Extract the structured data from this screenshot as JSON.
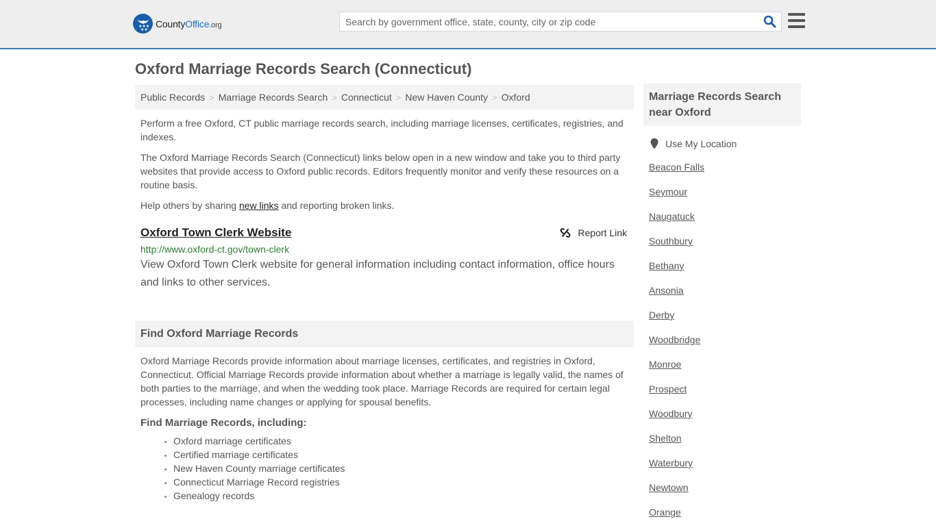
{
  "header": {
    "logo": {
      "name_part1": "County",
      "name_part2": "Office",
      "name_suffix": ".org"
    },
    "search": {
      "placeholder": "Search by government office, state, county, city or zip code",
      "value": ""
    },
    "colors": {
      "brand_blue": "#1a5ea8",
      "header_border": "#3b7bb5",
      "header_bg": "#eeeeee"
    }
  },
  "page": {
    "title": "Oxford Marriage Records Search (Connecticut)"
  },
  "breadcrumb": [
    {
      "label": "Public Records"
    },
    {
      "label": "Marriage Records Search"
    },
    {
      "label": "Connecticut"
    },
    {
      "label": "New Haven County"
    },
    {
      "label": "Oxford"
    }
  ],
  "intro": {
    "p1": "Perform a free Oxford, CT public marriage records search, including marriage licenses, certificates, registries, and indexes.",
    "p2": "The Oxford Marriage Records Search (Connecticut) links below open in a new window and take you to third party websites that provide access to Oxford public records. Editors frequently monitor and verify these resources on a routine basis.",
    "p3_before": "Help others by sharing ",
    "p3_link": "new links",
    "p3_after": " and reporting broken links."
  },
  "resource": {
    "title": "Oxford Town Clerk Website",
    "report_label": "Report Link",
    "url": "http://www.oxford-ct.gov/town-clerk",
    "description": "View Oxford Town Clerk website for general information including contact information, office hours and links to other services."
  },
  "find_section": {
    "heading": "Find Oxford Marriage Records",
    "body": "Oxford Marriage Records provide information about marriage licenses, certificates, and registries in Oxford, Connecticut. Official Marriage Records provide information about whether a marriage is legally valid, the names of both parties to the marriage, and when the wedding took place. Marriage Records are required for certain legal processes, including name changes or applying for spousal benefits.",
    "subheading": "Find Marriage Records, including:",
    "items": [
      "Oxford marriage certificates",
      "Certified marriage certificates",
      "New Haven County marriage certificates",
      "Connecticut Marriage Record registries",
      "Genealogy records"
    ]
  },
  "sidebar": {
    "heading": "Marriage Records Search near Oxford",
    "use_location": "Use My Location",
    "places": [
      "Beacon Falls",
      "Seymour",
      "Naugatuck",
      "Southbury",
      "Bethany",
      "Ansonia",
      "Derby",
      "Woodbridge",
      "Monroe",
      "Prospect",
      "Woodbury",
      "Shelton",
      "Waterbury",
      "Newtown",
      "Orange"
    ]
  }
}
